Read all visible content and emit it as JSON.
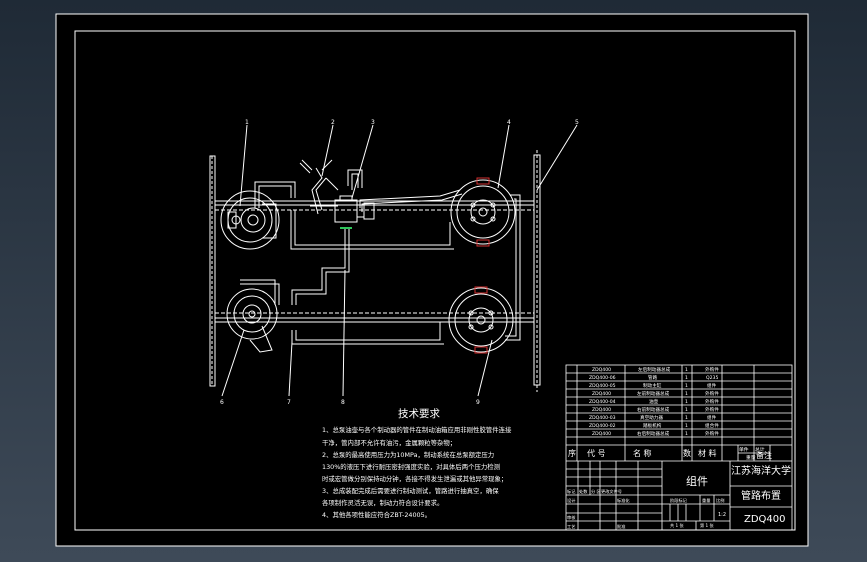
{
  "notes": {
    "title": "技术要求",
    "items": [
      "1、总泵油壶与各个制动器的管件在制动油箱应用非刚性胶管件连接",
      "干净，管内部不允许有油污，金属颗粒等杂物；",
      "2、总泵的最高使用压力为10MPa，制动系统在总泵额定压力",
      "130%的液压下进行耐压密封强度实验，对具体后两个压力检测",
      "时或宏管做分别保持动分钟，各接不得发生泄漏或其他异常现象；",
      "3、总成装配完成后需要进行制动测试，管路进行抽真空，确保",
      "各项制作灵活无误，制动力符合设计要求。",
      "4、其他各项性能应符合ZBT-24005。"
    ]
  },
  "parts": [
    {
      "code": "ZDQ400",
      "name": "左后制动器总成",
      "qty": "1",
      "note": "外购件"
    },
    {
      "code": "ZDQ400-06",
      "name": "管路",
      "qty": "1",
      "note": "Q235"
    },
    {
      "code": "ZDQ400-05",
      "name": "制动主缸",
      "qty": "1",
      "note": "组件"
    },
    {
      "code": "ZDQ400",
      "name": "左前制动器总成",
      "qty": "1",
      "note": "外购件"
    },
    {
      "code": "ZDQ400-04",
      "name": "油壶",
      "qty": "1",
      "note": "外购件"
    },
    {
      "code": "ZDQ400",
      "name": "右前制动器总成",
      "qty": "1",
      "note": "外购件"
    },
    {
      "code": "ZDQ400-03",
      "name": "真空助力器",
      "qty": "1",
      "note": "组件"
    },
    {
      "code": "ZDQ400-02",
      "name": "踏板机构",
      "qty": "1",
      "note": "组合件"
    },
    {
      "code": "ZDQ400",
      "name": "右后制动器总成",
      "qty": "1",
      "note": "外购件"
    }
  ],
  "header_row": {
    "seq": "序",
    "code": "代  号",
    "name": "名    称",
    "qty": "数",
    "material": "材  料",
    "unit_weight": "单件",
    "total_weight": "总计",
    "weight_group": "重量",
    "note": "备注"
  },
  "title_block": {
    "component_label": "组件",
    "university": "江苏海洋大学",
    "drawing_name": "管路布置",
    "drawing_code": "ZDQ400",
    "stage_label": "阶段标记",
    "weight_label": "重量",
    "scale_label": "比例",
    "scale_value": "1:2",
    "sheet_total": "共 1 张",
    "sheet_no": "第 1 张",
    "rev_labels": [
      "标记",
      "处数",
      "分  区",
      "更改文件号"
    ],
    "signer_labels": [
      "设计",
      "审核",
      "工艺"
    ],
    "std_label": "标准化",
    "approve_label": "批准"
  },
  "callouts": [
    "1",
    "2",
    "3",
    "4",
    "5",
    "6",
    "7",
    "8",
    "9"
  ],
  "colors": {
    "background": "#000000",
    "line": "#ffffff",
    "accent_red": "#d23030",
    "accent_green": "#2ec45a"
  }
}
